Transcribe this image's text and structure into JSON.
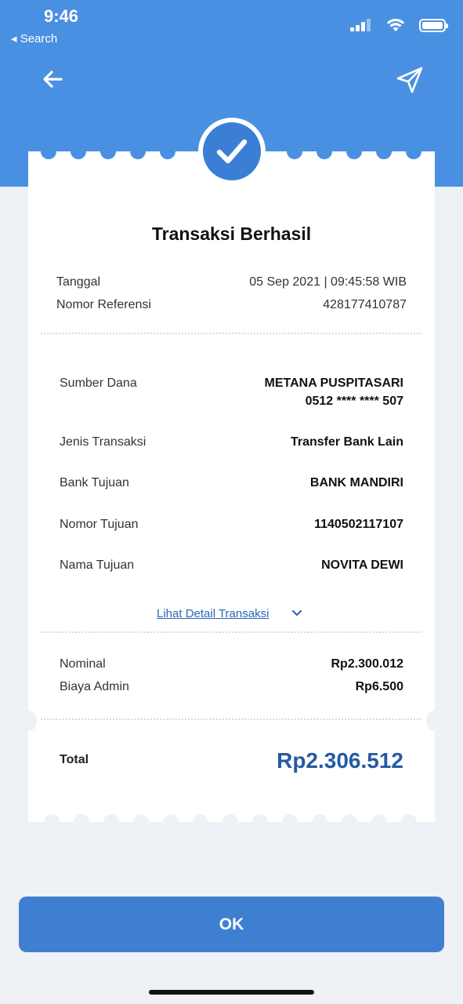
{
  "status_bar": {
    "time": "9:46",
    "back_label": "◂ Search"
  },
  "icons": {
    "back": "arrow-left-icon",
    "share": "send-icon",
    "success": "checkmark-icon",
    "expand": "chevron-down-icon"
  },
  "colors": {
    "header": "#4a90e2",
    "accent": "#245aa3",
    "button": "#3f7fd2",
    "link": "#2b67b8"
  },
  "receipt": {
    "title": "Transaksi Berhasil",
    "meta": [
      {
        "label": "Tanggal",
        "value": "05 Sep 2021 | 09:45:58 WIB"
      },
      {
        "label": "Nomor Referensi",
        "value": "428177410787"
      }
    ],
    "details": [
      {
        "label": "Sumber Dana",
        "value": "METANA PUSPITASARI",
        "value2": "0512 **** **** 507"
      },
      {
        "label": "Jenis Transaksi",
        "value": "Transfer Bank Lain"
      },
      {
        "label": "Bank Tujuan",
        "value": "BANK MANDIRI"
      },
      {
        "label": "Nomor Tujuan",
        "value": "1140502117107"
      },
      {
        "label": "Nama Tujuan",
        "value": "NOVITA DEWI"
      }
    ],
    "detail_link": "Lihat Detail Transaksi",
    "amounts": [
      {
        "label": "Nominal",
        "value": "Rp2.300.012"
      },
      {
        "label": "Biaya Admin",
        "value": "Rp6.500"
      }
    ],
    "total_label": "Total",
    "total_value": "Rp2.306.512"
  },
  "ok_button": "OK"
}
